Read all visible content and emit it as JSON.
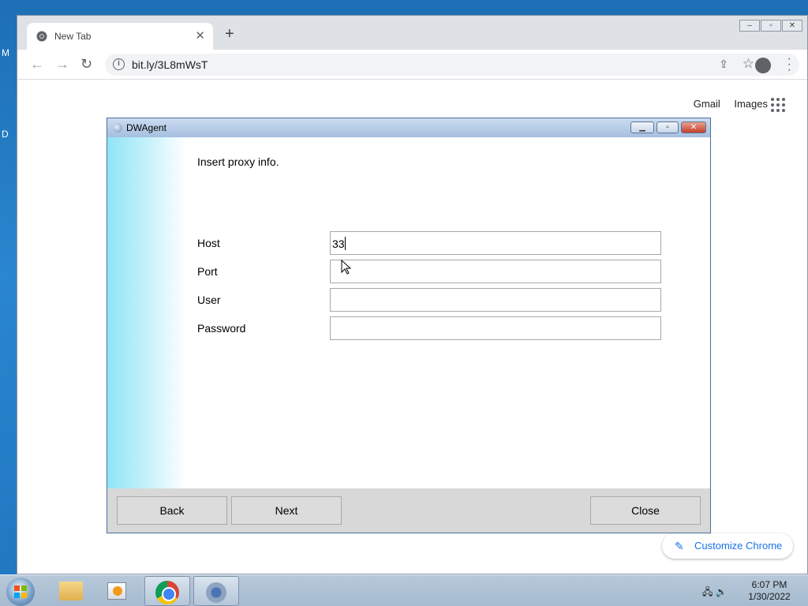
{
  "desktop": {
    "edge_letters": [
      "M",
      "D"
    ]
  },
  "browser": {
    "tab_title": "New Tab",
    "tab_close_glyph": "✕",
    "new_tab_glyph": "+",
    "url": "bit.ly/3L8mWsT",
    "ntp_links": [
      "Gmail",
      "Images"
    ],
    "customize_label": "Customize Chrome",
    "icons": {
      "back": "arrow-left-icon",
      "forward": "arrow-right-icon",
      "reload": "reload-icon",
      "info": "info-icon",
      "share": "share-icon",
      "bookmark": "star-icon",
      "profile": "profile-icon",
      "menu": "kebab-menu-icon",
      "apps": "apps-grid-icon"
    }
  },
  "dialog": {
    "title": "DWAgent",
    "message": "Insert proxy info.",
    "fields": [
      {
        "label": "Host",
        "value": "33"
      },
      {
        "label": "Port",
        "value": ""
      },
      {
        "label": "User",
        "value": ""
      },
      {
        "label": "Password",
        "value": ""
      }
    ],
    "buttons": {
      "back": "Back",
      "next": "Next",
      "close": "Close"
    },
    "colors": {
      "title_bar": "#b8cde7",
      "side_accent": "#8fe4f6",
      "footer": "#d8d8d8"
    }
  },
  "taskbar": {
    "items": [
      "windows-explorer",
      "media-player",
      "chrome",
      "dwagent"
    ],
    "time": "6:07 PM",
    "date": "1/30/2022"
  }
}
